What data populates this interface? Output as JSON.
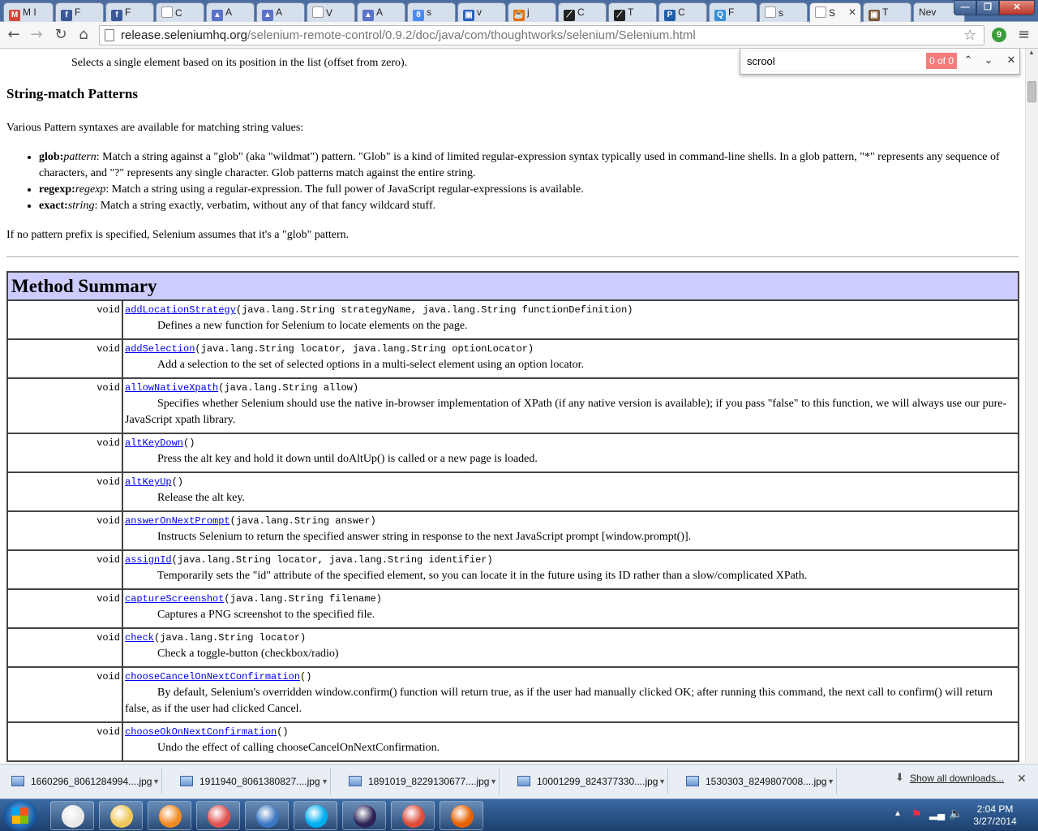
{
  "tabs": [
    {
      "label": "M I",
      "icon": "gmail-icon",
      "fav_color": "#d14836",
      "fav_char": "M"
    },
    {
      "label": "F",
      "icon": "facebook-icon",
      "fav_color": "#3b5998",
      "fav_char": "f"
    },
    {
      "label": "F",
      "icon": "facebook-icon",
      "fav_color": "#3b5998",
      "fav_char": "f"
    },
    {
      "label": "C",
      "icon": "page-icon",
      "fav_color": "#999999",
      "fav_char": ""
    },
    {
      "label": "A",
      "icon": "triangle-icon",
      "fav_color": "#5a73c8",
      "fav_char": "▲"
    },
    {
      "label": "A",
      "icon": "triangle-icon",
      "fav_color": "#5a73c8",
      "fav_char": "▲"
    },
    {
      "label": "V",
      "icon": "page-icon",
      "fav_color": "#999999",
      "fav_char": ""
    },
    {
      "label": "A",
      "icon": "triangle-icon",
      "fav_color": "#5a73c8",
      "fav_char": "▲"
    },
    {
      "label": "s",
      "icon": "google-icon",
      "fav_color": "#4a8af4",
      "fav_char": "8"
    },
    {
      "label": "v",
      "icon": "blue-square-icon",
      "fav_color": "#2a62b9",
      "fav_char": "▣"
    },
    {
      "label": "j",
      "icon": "java-icon",
      "fav_color": "#e76f00",
      "fav_char": "☕"
    },
    {
      "label": "C",
      "icon": "dark-logo-icon",
      "fav_color": "#222222",
      "fav_char": "⟋"
    },
    {
      "label": "T",
      "icon": "dark-logo-icon",
      "fav_color": "#222222",
      "fav_char": "⟋"
    },
    {
      "label": "C",
      "icon": "ps-icon",
      "fav_color": "#1f5fa8",
      "fav_char": "P"
    },
    {
      "label": "F",
      "icon": "qa-icon",
      "fav_color": "#3a8fd6",
      "fav_char": "Q"
    },
    {
      "label": "s",
      "icon": "page-icon",
      "fav_color": "#999999",
      "fav_char": ""
    },
    {
      "label": "S",
      "icon": "page-icon",
      "fav_color": "#999999",
      "fav_char": "",
      "active": true
    },
    {
      "label": "T",
      "icon": "photo-icon",
      "fav_color": "#7a5a3a",
      "fav_char": "▣"
    },
    {
      "label": "Nev",
      "icon": "",
      "fav_color": "",
      "fav_char": ""
    }
  ],
  "window_controls": {
    "minimize": "—",
    "maximize": "❐",
    "close": "✕"
  },
  "address": {
    "host": "release.seleniumhq.org",
    "path": "/selenium-remote-control/0.9.2/doc/java/com/thoughtworks/selenium/Selenium.html"
  },
  "find": {
    "query": "scrool",
    "count": "0 of 0"
  },
  "content": {
    "intro": "Selects a single element based on its position in the list (offset from zero).",
    "heading": "String-match Patterns",
    "p1": "Various Pattern syntaxes are available for matching string values:",
    "bullets": [
      {
        "term": "glob:",
        "arg": "pattern",
        "text": ": Match a string against a \"glob\" (aka \"wildmat\") pattern. \"Glob\" is a kind of limited regular-expression syntax typically used in command-line shells. In a glob pattern, \"*\" represents any sequence of characters, and \"?\" represents any single character. Glob patterns match against the entire string."
      },
      {
        "term": "regexp:",
        "arg": "regexp",
        "text": ": Match a string using a regular-expression. The full power of JavaScript regular-expressions is available."
      },
      {
        "term": "exact:",
        "arg": "string",
        "text": ": Match a string exactly, verbatim, without any of that fancy wildcard stuff."
      }
    ],
    "p2": "If no pattern prefix is specified, Selenium assumes that it's a \"glob\" pattern.",
    "summary_title": "Method Summary",
    "methods": [
      {
        "ret": "void",
        "name": "addLocationStrategy",
        "sig": "(java.lang.String strategyName, java.lang.String functionDefinition)",
        "desc": "Defines a new function for Selenium to locate elements on the page."
      },
      {
        "ret": "void",
        "name": "addSelection",
        "sig": "(java.lang.String locator, java.lang.String optionLocator)",
        "desc": "Add a selection to the set of selected options in a multi-select element using an option locator."
      },
      {
        "ret": "void",
        "name": "allowNativeXpath",
        "sig": "(java.lang.String allow)",
        "desc": "Specifies whether Selenium should use the native in-browser implementation of XPath (if any native version is available); if you pass \"false\" to this function, we will always use our pure-JavaScript xpath library."
      },
      {
        "ret": "void",
        "name": "altKeyDown",
        "sig": "()",
        "desc": "Press the alt key and hold it down until doAltUp() is called or a new page is loaded."
      },
      {
        "ret": "void",
        "name": "altKeyUp",
        "sig": "()",
        "desc": "Release the alt key."
      },
      {
        "ret": "void",
        "name": "answerOnNextPrompt",
        "sig": "(java.lang.String answer)",
        "desc": "Instructs Selenium to return the specified answer string in response to the next JavaScript prompt [window.prompt()]."
      },
      {
        "ret": "void",
        "name": "assignId",
        "sig": "(java.lang.String locator, java.lang.String identifier)",
        "desc": "Temporarily sets the \"id\" attribute of the specified element, so you can locate it in the future using its ID rather than a slow/complicated XPath."
      },
      {
        "ret": "void",
        "name": "captureScreenshot",
        "sig": "(java.lang.String filename)",
        "desc": "Captures a PNG screenshot to the specified file."
      },
      {
        "ret": "void",
        "name": "check",
        "sig": "(java.lang.String locator)",
        "desc": "Check a toggle-button (checkbox/radio)"
      },
      {
        "ret": "void",
        "name": "chooseCancelOnNextConfirmation",
        "sig": "()",
        "desc": "By default, Selenium's overridden window.confirm() function will return true, as if the user had manually clicked OK; after running this command, the next call to confirm() will return false, as if the user had clicked Cancel."
      },
      {
        "ret": "void",
        "name": "chooseOkOnNextConfirmation",
        "sig": "()",
        "desc": "Undo the effect of calling chooseCancelOnNextConfirmation."
      }
    ]
  },
  "downloads": {
    "items": [
      "1660296_8061284994....jpg",
      "1911940_8061380827....jpg",
      "1891019_8229130677....jpg",
      "10001299_824377330....jpg",
      "1530303_8249807008....jpg"
    ],
    "show_all": "Show all downloads..."
  },
  "taskbar": {
    "apps": [
      {
        "name": "spreadsheet-app-icon",
        "color": "#e8e8e8"
      },
      {
        "name": "explorer-icon",
        "color": "#f0c75a"
      },
      {
        "name": "media-player-icon",
        "color": "#f08a24"
      },
      {
        "name": "paint-icon",
        "color": "#e05252"
      },
      {
        "name": "thunderbird-icon",
        "color": "#3f78c2"
      },
      {
        "name": "skype-icon",
        "color": "#00aff0"
      },
      {
        "name": "eclipse-icon",
        "color": "#2c2255"
      },
      {
        "name": "chrome-icon",
        "color": "#dd4b39"
      },
      {
        "name": "firefox-icon",
        "color": "#e66000"
      }
    ],
    "time": "2:04 PM",
    "date": "3/27/2014"
  }
}
